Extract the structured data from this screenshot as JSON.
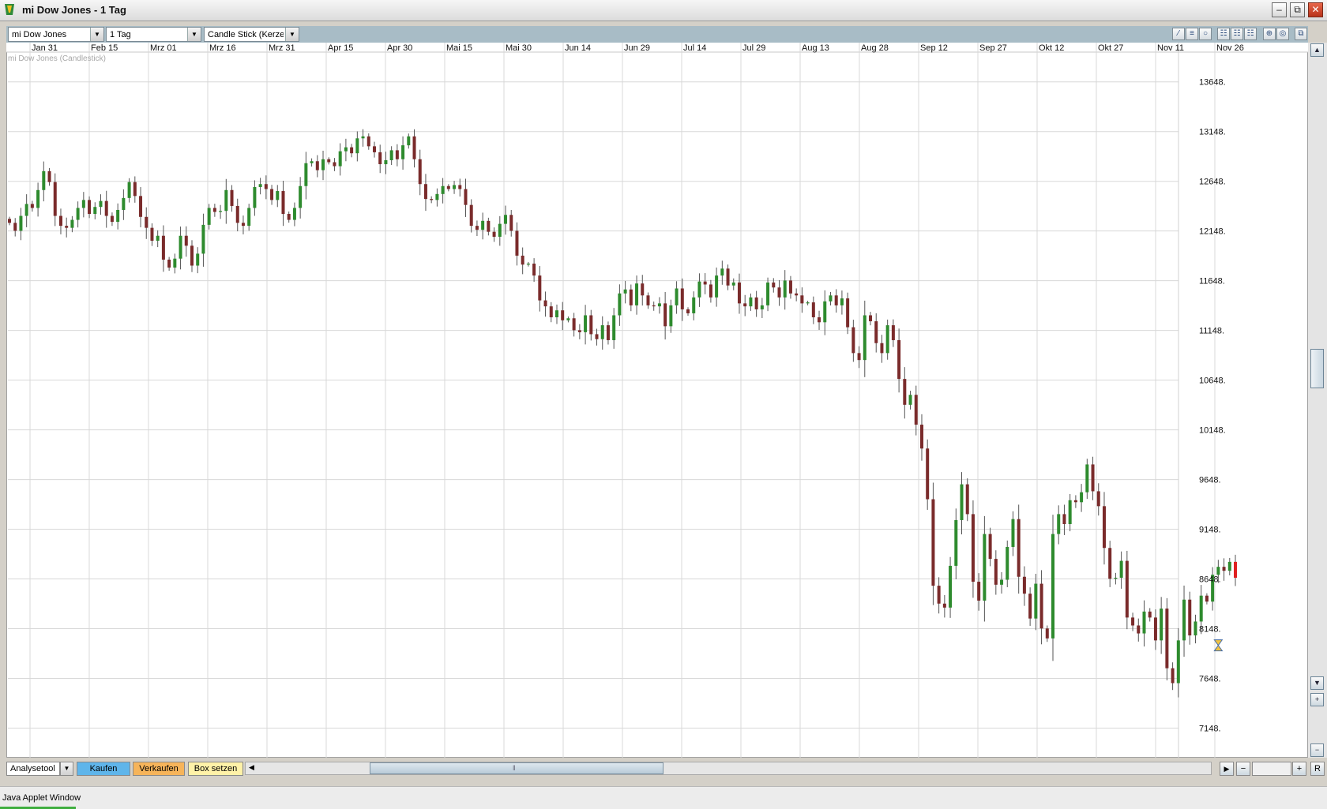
{
  "window": {
    "title": "mi Dow Jones - 1 Tag"
  },
  "toolbar": {
    "instrument": "mi Dow Jones",
    "period": "1 Tag",
    "chart_type": "Candle Stick (Kerzen",
    "icons": [
      "pencil-icon",
      "lines-icon",
      "circle-icon",
      "grid-icon",
      "grid-alt-icon",
      "grid-alt2-icon",
      "zoom-in-icon",
      "settings-icon",
      "window-icon"
    ]
  },
  "bottom": {
    "analysis": "Analysetool",
    "buy": "Kaufen",
    "sell": "Verkaufen",
    "box": "Box setzen",
    "reset": "R"
  },
  "status": {
    "text": "Java Applet Window"
  },
  "colors": {
    "up": "#2e8b2e",
    "down": "#7a2b2b",
    "last_down": "#e02020",
    "grid": "#d8d8d8"
  },
  "chart_data": {
    "type": "candlestick",
    "title": "mi Dow Jones (Candlestick)",
    "x_ticks": [
      "Jan 31",
      "Feb 15",
      "Mrz 01",
      "Mrz 16",
      "Mrz 31",
      "Apr 15",
      "Apr 30",
      "Mai 15",
      "Mai 30",
      "Jun 14",
      "Jun 29",
      "Jul 14",
      "Jul 29",
      "Aug 13",
      "Aug 28",
      "Sep 12",
      "Sep 27",
      "Okt 12",
      "Okt 27",
      "Nov 11",
      "Nov 26"
    ],
    "y_ticks": [
      "13648.",
      "13148.",
      "12648.",
      "12148.",
      "11648.",
      "11148.",
      "10648.",
      "10148.",
      "9648.",
      "9148.",
      "8648.",
      "8148.",
      "7648.",
      "7148."
    ],
    "ylim": [
      6850,
      13900
    ],
    "y_tick_values": [
      13648,
      13148,
      12648,
      12148,
      11648,
      11148,
      10648,
      10148,
      9648,
      9148,
      8648,
      8148,
      7648,
      7148
    ],
    "grid": true,
    "closes": [
      12230,
      12150,
      12300,
      12420,
      12380,
      12560,
      12750,
      12640,
      12300,
      12200,
      12180,
      12260,
      12380,
      12460,
      12320,
      12390,
      12450,
      12300,
      12240,
      12360,
      12480,
      12640,
      12500,
      12290,
      12180,
      12050,
      12100,
      11860,
      11780,
      11870,
      12100,
      12000,
      11800,
      11920,
      12210,
      12380,
      12340,
      12350,
      12560,
      12400,
      12230,
      12200,
      12380,
      12590,
      12620,
      12570,
      12460,
      12550,
      12320,
      12260,
      12380,
      12600,
      12830,
      12850,
      12760,
      12870,
      12840,
      12800,
      12950,
      12990,
      12930,
      13080,
      13100,
      13000,
      12940,
      12820,
      12860,
      12960,
      12870,
      13010,
      13100,
      12870,
      12620,
      12470,
      12460,
      12520,
      12600,
      12570,
      12610,
      12570,
      12410,
      12200,
      12160,
      12250,
      12140,
      12090,
      12220,
      12310,
      12150,
      11900,
      11810,
      11820,
      11700,
      11450,
      11390,
      11280,
      11350,
      11250,
      11270,
      11150,
      11130,
      11300,
      11110,
      11060,
      11200,
      11050,
      11300,
      11520,
      11560,
      11400,
      11620,
      11500,
      11400,
      11390,
      11420,
      11190,
      11400,
      11570,
      11360,
      11320,
      11480,
      11640,
      11610,
      11480,
      11700,
      11770,
      11600,
      11630,
      11420,
      11390,
      11480,
      11360,
      11400,
      11630,
      11580,
      11480,
      11650,
      11520,
      11500,
      11420,
      11430,
      11280,
      11230,
      11440,
      11500,
      11400,
      11470,
      11180,
      10920,
      10850,
      11300,
      11240,
      11020,
      10920,
      11200,
      11050,
      10660,
      10400,
      10500,
      10200,
      9960,
      9450,
      8580,
      8400,
      8360,
      8780,
      9240,
      9600,
      9300,
      8620,
      8430,
      9100,
      8850,
      8590,
      8640,
      8970,
      9250,
      8670,
      8500,
      8250,
      8600,
      8150,
      8050,
      9100,
      9300,
      9200,
      9440,
      9420,
      9520,
      9800,
      9530,
      9380,
      8960,
      8650,
      8660,
      8830,
      8260,
      8180,
      8100,
      8320,
      8260,
      8030,
      8350,
      7750,
      7600,
      8030,
      8440,
      8080,
      8220,
      8480,
      8420,
      8690,
      8770,
      8730,
      8820,
      8660
    ]
  }
}
